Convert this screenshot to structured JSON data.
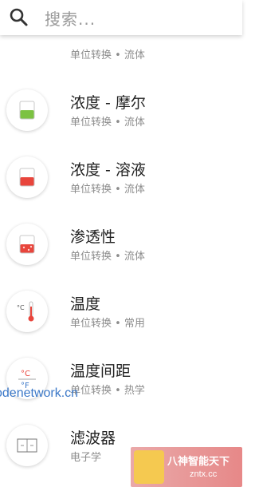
{
  "search": {
    "placeholder": "搜索..."
  },
  "items": [
    {
      "title": "",
      "subtitle": "单位转换 • 流体",
      "icon": "partial-icon"
    },
    {
      "title": "浓度 - 摩尔",
      "subtitle": "单位转换 • 流体",
      "icon": "beaker-green-icon"
    },
    {
      "title": "浓度 - 溶液",
      "subtitle": "单位转换 • 流体",
      "icon": "beaker-red-icon"
    },
    {
      "title": "渗透性",
      "subtitle": "单位转换 • 流体",
      "icon": "beaker-red-dots-icon"
    },
    {
      "title": "温度",
      "subtitle": "单位转换 • 常用",
      "icon": "thermometer-icon"
    },
    {
      "title": "温度间距",
      "subtitle": "单位转换 • 热学",
      "icon": "temperature-interval-icon"
    },
    {
      "title": "滤波器",
      "subtitle": "电子学",
      "icon": "filter-circuit-icon"
    }
  ],
  "watermarks": {
    "left_text": "odenetwork.cn",
    "logo_text": "八神智能天下",
    "logo_url": "zntx.cc"
  },
  "colors": {
    "green_fill": "#7cc242",
    "red_fill": "#e8453c",
    "title_text": "#222222",
    "subtitle_text": "#8c8c8c"
  }
}
